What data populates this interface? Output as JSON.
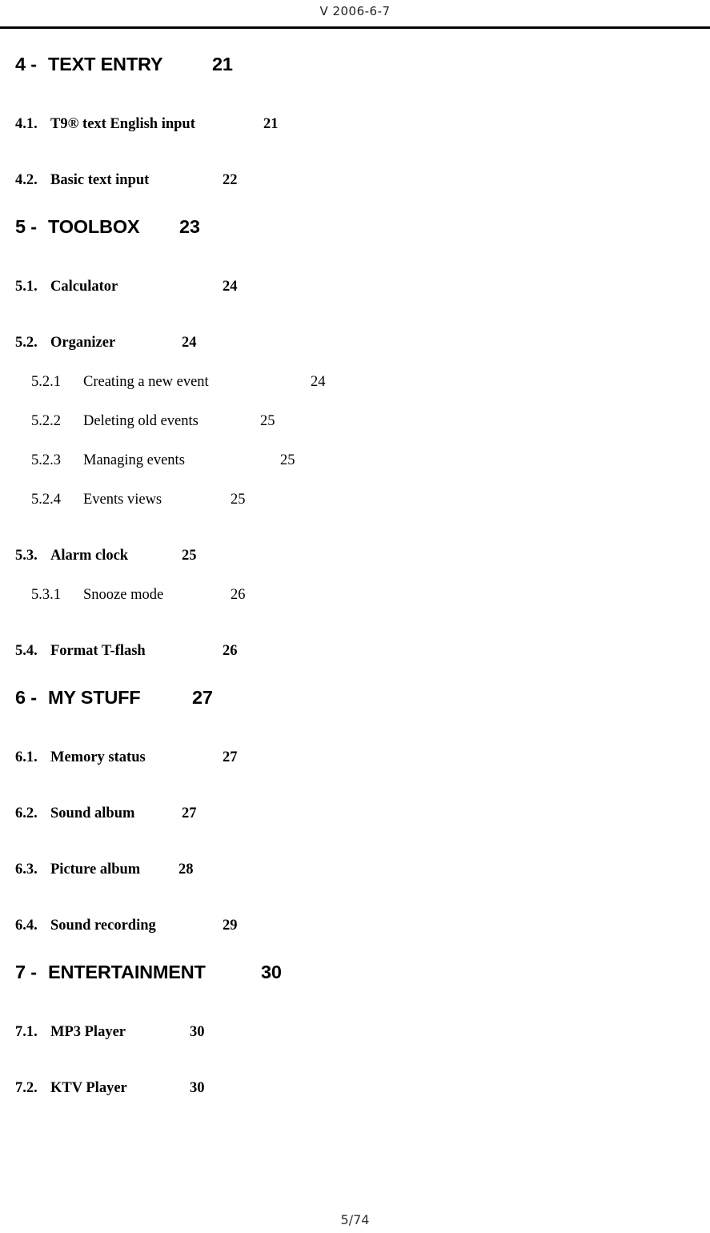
{
  "header": {
    "version_text": "V 2006-6-7"
  },
  "footer": {
    "page_indicator": "5/74"
  },
  "toc": {
    "entries": [
      {
        "level": 1,
        "number": "4 -",
        "title": "TEXT ENTRY",
        "page": "21",
        "num_width": 41,
        "tab": 205
      },
      {
        "level": 2,
        "number": "4.1.",
        "title": "T9® text English input",
        "page": "21",
        "num_width": 44,
        "tab": 266
      },
      {
        "level": 2,
        "number": "4.2.",
        "title": "Basic text input",
        "page": "22",
        "num_width": 44,
        "tab": 215
      },
      {
        "level": 1,
        "number": "5 -",
        "title": "TOOLBOX",
        "page": "23",
        "num_width": 41,
        "tab": 164
      },
      {
        "level": 2,
        "number": "5.1.",
        "title": "Calculator",
        "page": "24",
        "num_width": 44,
        "tab": 215
      },
      {
        "level": 2,
        "number": "5.2.",
        "title": "Organizer",
        "page": "24",
        "num_width": 44,
        "tab": 164
      },
      {
        "level": 3,
        "number": "5.2.1",
        "title": "Creating a new event",
        "page": "24",
        "num_width": 65,
        "tab": 284
      },
      {
        "level": 3,
        "number": "5.2.2",
        "title": "Deleting old events",
        "page": "25",
        "num_width": 65,
        "tab": 221
      },
      {
        "level": 3,
        "number": "5.2.3",
        "title": "Managing events",
        "page": "25",
        "num_width": 65,
        "tab": 246
      },
      {
        "level": 3,
        "number": "5.2.4",
        "title": "Events views",
        "page": "25",
        "num_width": 65,
        "tab": 184
      },
      {
        "level": 2,
        "number": "5.3.",
        "title": "Alarm clock",
        "page": "25",
        "num_width": 44,
        "tab": 164
      },
      {
        "level": 3,
        "number": "5.3.1",
        "title": "Snooze mode",
        "page": "26",
        "num_width": 65,
        "tab": 184
      },
      {
        "level": 2,
        "number": "5.4.",
        "title": "Format T-flash",
        "page": "26",
        "num_width": 44,
        "tab": 215
      },
      {
        "level": 1,
        "number": "6 -",
        "title": "MY STUFF",
        "page": "27",
        "num_width": 41,
        "tab": 180
      },
      {
        "level": 2,
        "number": "6.1.",
        "title": "Memory status",
        "page": "27",
        "num_width": 44,
        "tab": 215
      },
      {
        "level": 2,
        "number": "6.2.",
        "title": "Sound album",
        "page": "27",
        "num_width": 44,
        "tab": 164
      },
      {
        "level": 2,
        "number": "6.3.",
        "title": "Picture album",
        "page": "28",
        "num_width": 44,
        "tab": 160
      },
      {
        "level": 2,
        "number": "6.4.",
        "title": "Sound recording",
        "page": "29",
        "num_width": 44,
        "tab": 215
      },
      {
        "level": 1,
        "number": "7 -",
        "title": "ENTERTAINMENT",
        "page": "30",
        "num_width": 41,
        "tab": 266
      },
      {
        "level": 2,
        "number": "7.1.",
        "title": "MP3 Player",
        "page": "30",
        "num_width": 44,
        "tab": 174
      },
      {
        "level": 2,
        "number": "7.2.",
        "title": "KTV Player",
        "page": "30",
        "num_width": 44,
        "tab": 174
      }
    ]
  }
}
